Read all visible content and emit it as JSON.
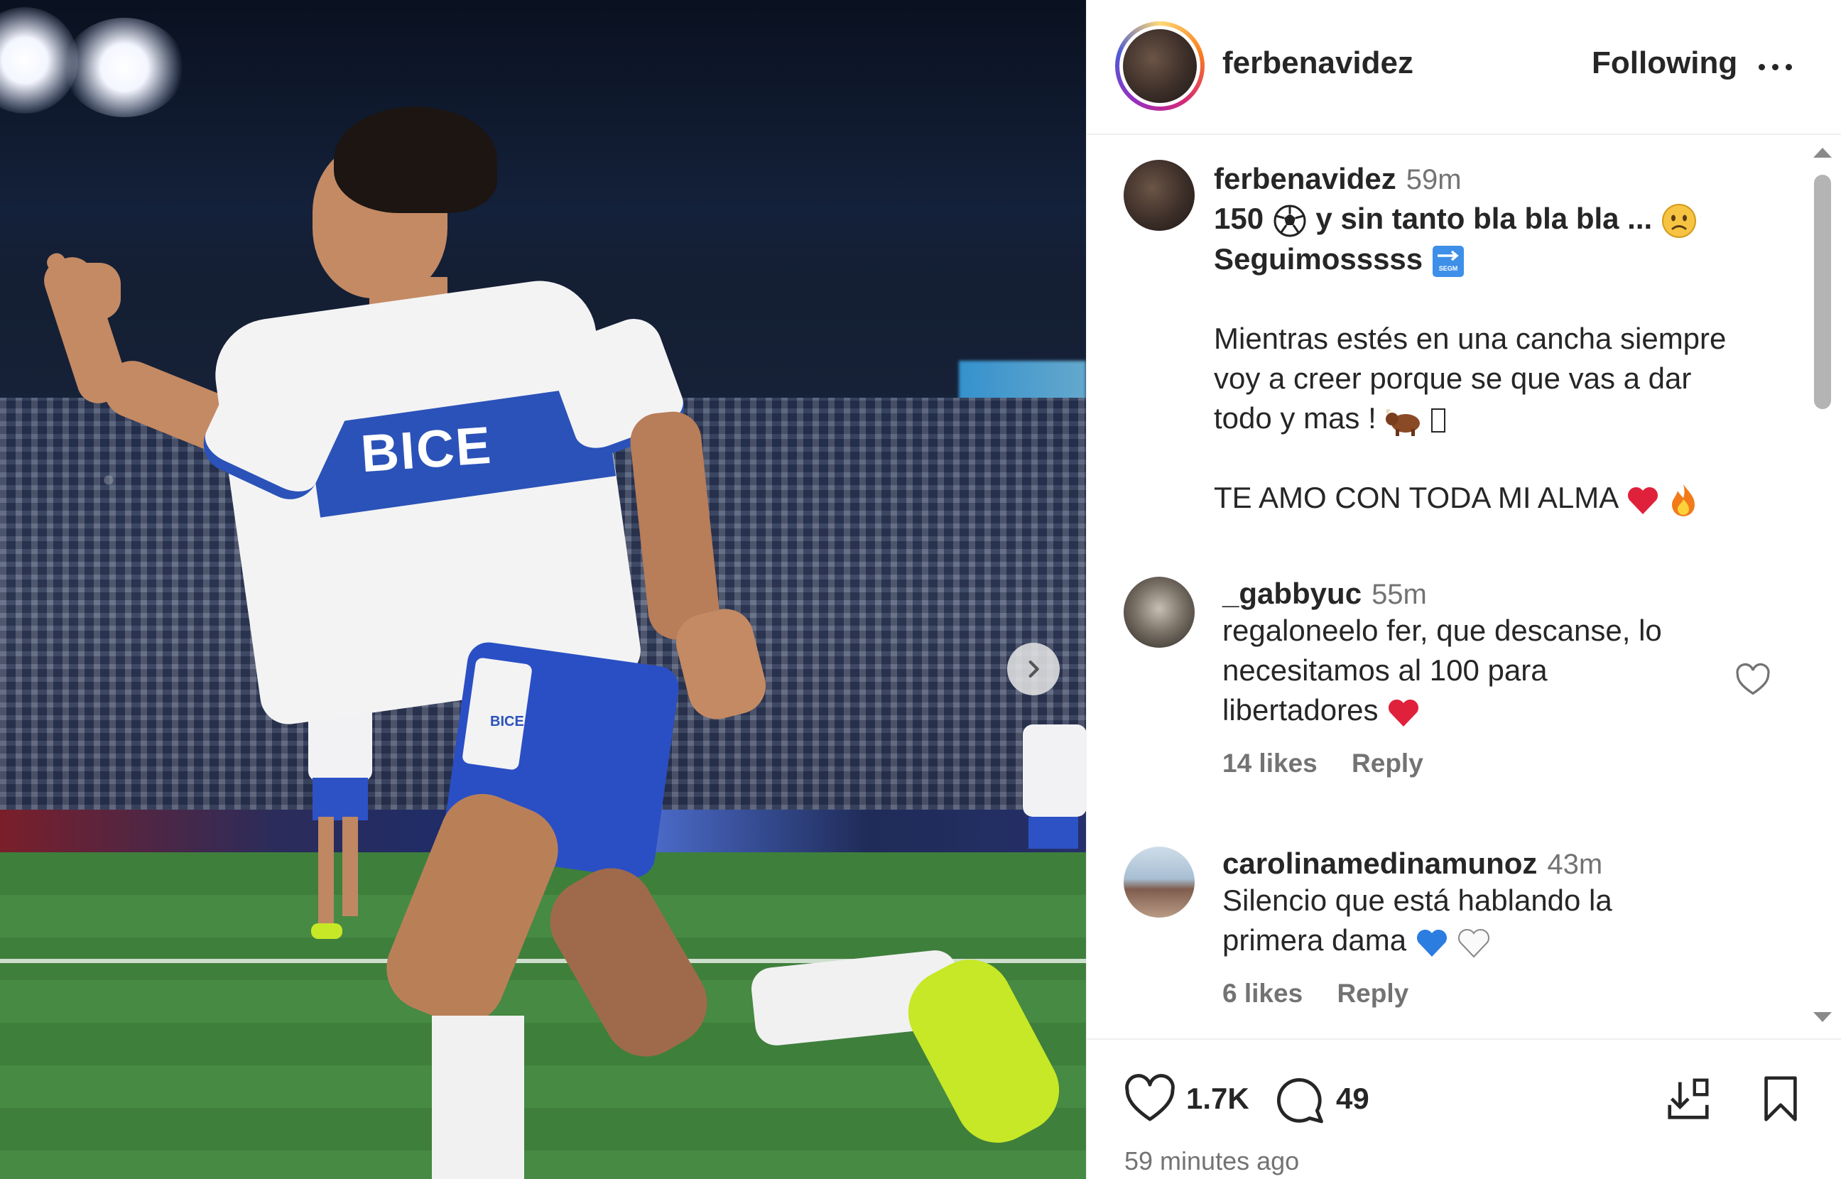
{
  "post": {
    "username": "ferbenavidez",
    "follow_state": "Following",
    "caption_time": "59m",
    "caption_line1": "150",
    "caption_line1b": "y sin tanto bla bla bla ...",
    "caption_line2": "Seguimosssss",
    "caption_para2_line1": "Mientras estés en una cancha siempre",
    "caption_para2_line2": "voy a creer porque se que vas a dar",
    "caption_para2_line3": "todo y mas !",
    "caption_para3": "TE AMO CON TODA MI ALMA",
    "image_brand_text": "BICE",
    "shorts_brand_text": "BICE"
  },
  "comments": [
    {
      "username": "_gabbyuc",
      "time": "55m",
      "line1": "regaloneelo fer, que descanse, lo",
      "line2": "necesitamos al 100 para",
      "line3": "libertadores",
      "likes": "14 likes",
      "reply": "Reply"
    },
    {
      "username": "carolinamedinamunoz",
      "time": "43m",
      "line1": "Silencio que está hablando la",
      "line2": "primera dama",
      "likes": "6 likes",
      "reply": "Reply"
    }
  ],
  "footer": {
    "like_count": "1.7K",
    "comment_count": "49",
    "posted": "59 minutes ago"
  },
  "icons": {
    "more": "more-horizontal-icon",
    "next": "chevron-right-icon",
    "like": "heart-icon",
    "comment": "comment-bubble-icon",
    "save_collection": "download-to-collection-icon",
    "bookmark": "bookmark-icon"
  },
  "colors": {
    "text": "#262626",
    "muted": "#737373",
    "heart_red": "#e0213b",
    "heart_blue": "#2b7de0",
    "jersey_blue": "#2b52b8",
    "boot_green": "#c6e826"
  }
}
